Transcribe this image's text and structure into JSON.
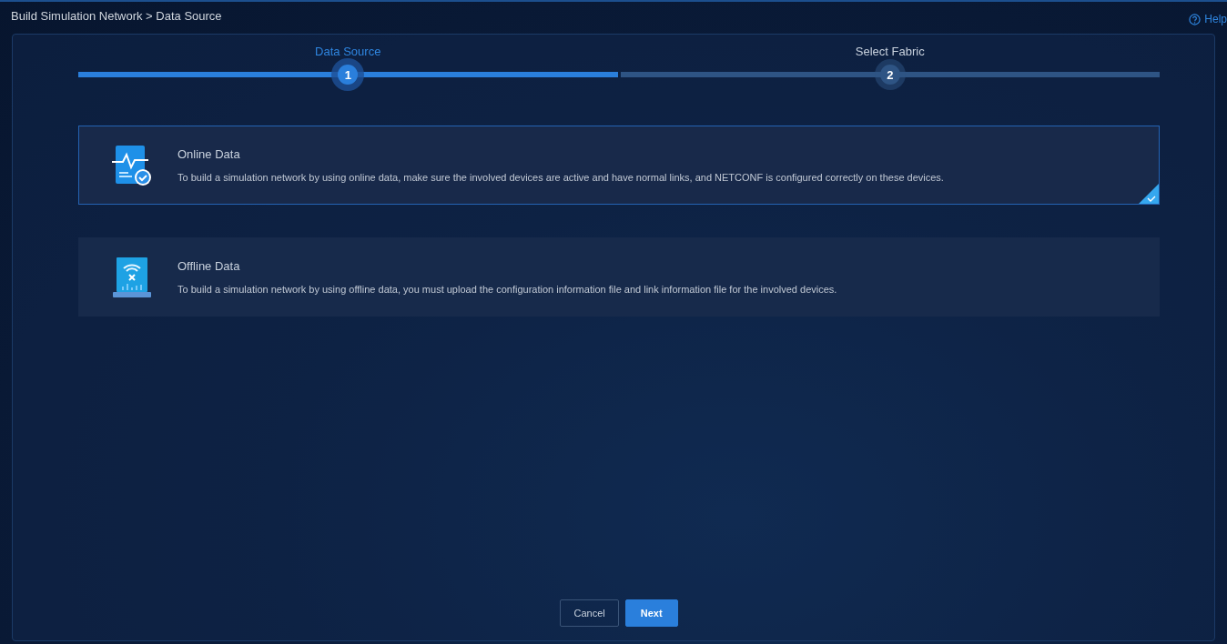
{
  "breadcrumb": "Build Simulation Network > Data Source",
  "help": "Help",
  "steps": [
    {
      "label": "Data Source",
      "number": "1",
      "active": true
    },
    {
      "label": "Select Fabric",
      "number": "2",
      "active": false
    }
  ],
  "options": [
    {
      "kind": "online",
      "title": "Online Data",
      "description": "To build a simulation network by using online data, make sure the involved devices are active and have normal links, and NETCONF is configured correctly on these devices.",
      "selected": true
    },
    {
      "kind": "offline",
      "title": "Offline Data",
      "description": "To build a simulation network by using offline data, you must upload the configuration information file and link information file for the involved devices.",
      "selected": false
    }
  ],
  "buttons": [
    {
      "kind": "secondary",
      "label": "Cancel"
    },
    {
      "kind": "primary",
      "label": "Next"
    }
  ]
}
